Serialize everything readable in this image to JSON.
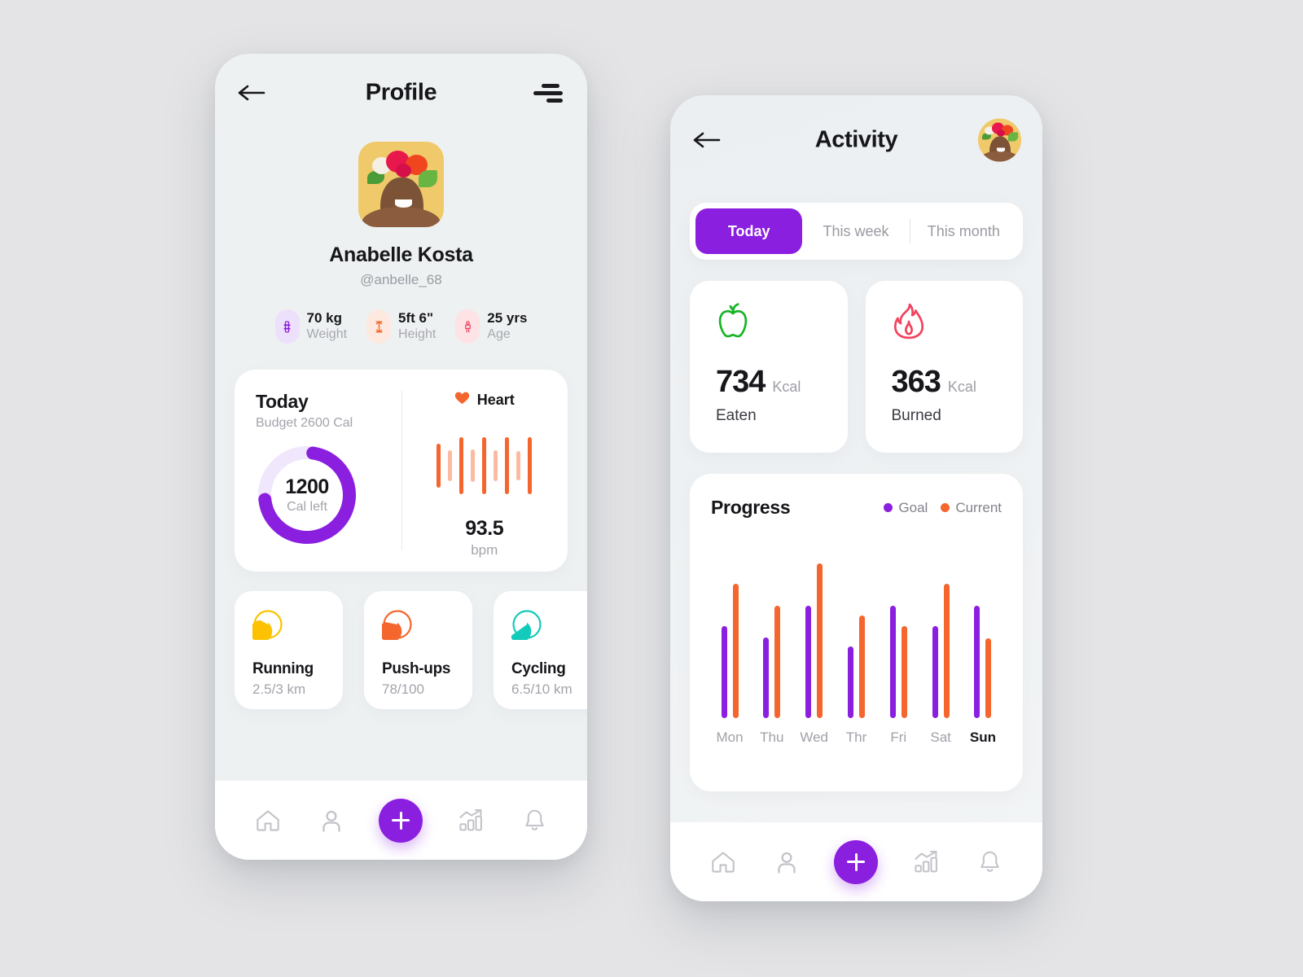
{
  "theme": {
    "purple": "#8b1fe0",
    "orange": "#f4662e",
    "orange_light": "#fbbba1",
    "green": "#17b525",
    "pink": "#f2435f",
    "yellow": "#fcc200",
    "teal": "#12cbbb",
    "page_bg": "#e4e4e6",
    "phone_bg": "#eef1f2",
    "card_bg": "#ffffff",
    "text_dark": "#17171b",
    "text_muted": "#a3a3ab"
  },
  "profile_screen": {
    "header": {
      "title": "Profile",
      "back_icon": "arrow-left-icon",
      "menu_icon": "hamburger-menu-icon"
    },
    "user": {
      "name": "Anabelle Kosta",
      "handle": "@anbelle_68",
      "avatar_icon": "user-avatar-photo"
    },
    "stats": [
      {
        "icon": "dumbbell-icon",
        "value": "70 kg",
        "label": "Weight",
        "color": "#8b1fe0",
        "bg": "#ece0fb"
      },
      {
        "icon": "height-ruler-icon",
        "value": "5ft 6\"",
        "label": "Height",
        "color": "#f4662e",
        "bg": "#fde9df"
      },
      {
        "icon": "person-icon",
        "value": "25 yrs",
        "label": "Age",
        "color": "#f2435f",
        "bg": "#fde2e6"
      }
    ],
    "today_card": {
      "heading": "Today",
      "subheading": "Budget 2600 Cal",
      "ring": {
        "value": "1200",
        "label": "Cal left",
        "percent": 71,
        "track_color": "#f1e7fc",
        "fill_color": "#8b1fe0"
      },
      "heart": {
        "icon": "heart-icon",
        "label": "Heart",
        "value": "93.5",
        "unit": "bpm",
        "bars": [
          {
            "h": 54,
            "shade": "dark"
          },
          {
            "h": 38,
            "shade": "light"
          },
          {
            "h": 70,
            "shade": "dark"
          },
          {
            "h": 40,
            "shade": "light"
          },
          {
            "h": 70,
            "shade": "dark"
          },
          {
            "h": 38,
            "shade": "light"
          },
          {
            "h": 70,
            "shade": "dark"
          },
          {
            "h": 36,
            "shade": "light"
          },
          {
            "h": 70,
            "shade": "dark"
          }
        ]
      }
    },
    "exercises": [
      {
        "name": "Running",
        "value": "2.5/3 km",
        "icon": "pie-progress-icon",
        "color": "#fcc200",
        "percent": 83
      },
      {
        "name": "Push-ups",
        "value": "78/100",
        "icon": "pie-progress-icon",
        "color": "#f4662e",
        "percent": 78
      },
      {
        "name": "Cycling",
        "value": "6.5/10 km",
        "icon": "pie-progress-icon",
        "color": "#12cbbb",
        "percent": 65
      }
    ],
    "navbar": [
      {
        "icon": "home-icon",
        "name": "nav-home"
      },
      {
        "icon": "person-icon",
        "name": "nav-profile"
      },
      {
        "icon": "plus-icon",
        "name": "nav-add"
      },
      {
        "icon": "chart-icon",
        "name": "nav-stats"
      },
      {
        "icon": "bell-icon",
        "name": "nav-notifications"
      }
    ]
  },
  "activity_screen": {
    "header": {
      "title": "Activity",
      "back_icon": "arrow-left-icon",
      "avatar_icon": "user-avatar-photo"
    },
    "tabs": [
      {
        "label": "Today",
        "active": true
      },
      {
        "label": "This week",
        "active": false
      },
      {
        "label": "This month",
        "active": false
      }
    ],
    "kcal_cards": [
      {
        "icon": "apple-icon",
        "value": "734",
        "unit": "Kcal",
        "label": "Eaten",
        "color": "#17b525"
      },
      {
        "icon": "flame-icon",
        "value": "363",
        "unit": "Kcal",
        "label": "Burned",
        "color": "#f2435f"
      }
    ],
    "progress": {
      "title": "Progress",
      "legend": [
        {
          "label": "Goal",
          "color": "#8b1fe0"
        },
        {
          "label": "Current",
          "color": "#f4662e"
        }
      ]
    },
    "navbar": [
      {
        "icon": "home-icon",
        "name": "nav-home"
      },
      {
        "icon": "person-icon",
        "name": "nav-profile"
      },
      {
        "icon": "plus-icon",
        "name": "nav-add"
      },
      {
        "icon": "chart-icon",
        "name": "nav-stats"
      },
      {
        "icon": "bell-icon",
        "name": "nav-notifications"
      }
    ]
  },
  "chart_data": {
    "type": "bar",
    "title": "Progress",
    "xlabel": "",
    "ylabel": "",
    "grid": false,
    "legend_position": "top-right",
    "categories": [
      "Mon",
      "Thu",
      "Wed",
      "Thr",
      "Fri",
      "Sat",
      "Sun"
    ],
    "highlighted_category": "Sun",
    "ylim": [
      0,
      240
    ],
    "series": [
      {
        "name": "Goal",
        "color": "#8b1fe0",
        "values": [
          136,
          119,
          166,
          105,
          166,
          136,
          165
        ]
      },
      {
        "name": "Current",
        "color": "#f4662e",
        "values": [
          198,
          166,
          228,
          151,
          136,
          198,
          118
        ]
      }
    ]
  }
}
